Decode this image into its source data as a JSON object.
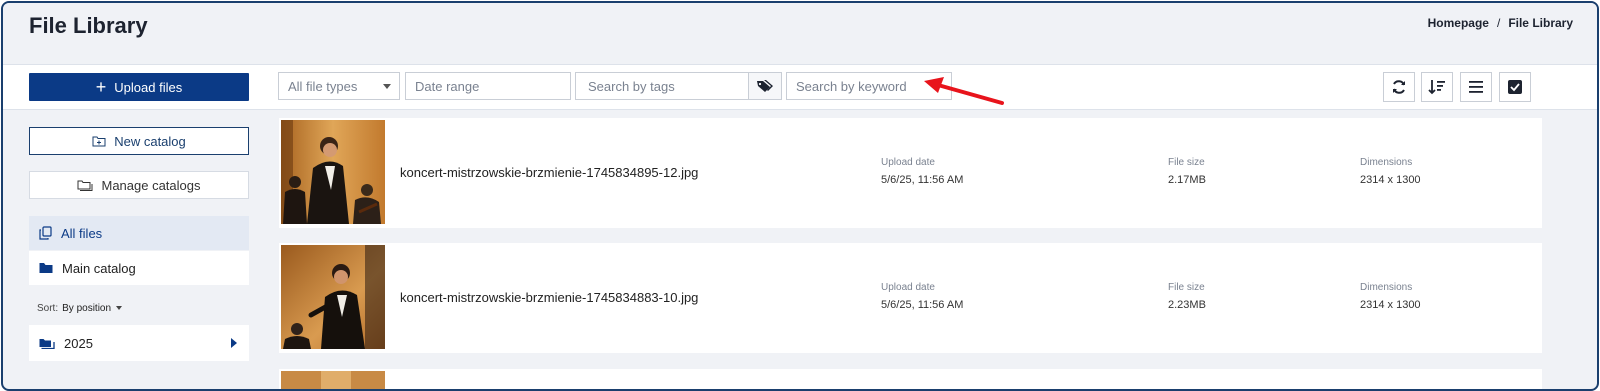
{
  "header": {
    "title": "File Library",
    "breadcrumb": [
      "Homepage",
      "File Library"
    ]
  },
  "toolbar": {
    "upload_label": "Upload files",
    "file_type_value": "All file types",
    "date_range_placeholder": "Date range",
    "tags_placeholder": "Search by tags",
    "keyword_placeholder": "Search by keyword"
  },
  "sidebar": {
    "new_catalog_label": "New catalog",
    "manage_catalogs_label": "Manage catalogs",
    "all_files_label": "All files",
    "main_catalog_label": "Main catalog",
    "sort_label": "Sort:",
    "sort_value": "By position",
    "year_folder_label": "2025"
  },
  "files": [
    {
      "name": "koncert-mistrzowskie-brzmienie-1745834895-12.jpg",
      "upload_label": "Upload date",
      "upload_date": "5/6/25, 11:56 AM",
      "size_label": "File size",
      "size": "2.17MB",
      "dim_label": "Dimensions",
      "dimensions": "2314 x 1300"
    },
    {
      "name": "koncert-mistrzowskie-brzmienie-1745834883-10.jpg",
      "upload_label": "Upload date",
      "upload_date": "5/6/25, 11:56 AM",
      "size_label": "File size",
      "size": "2.23MB",
      "dim_label": "Dimensions",
      "dimensions": "2314 x 1300"
    }
  ],
  "colors": {
    "brand": "#0b3a86",
    "annotation_arrow": "#e8141c"
  },
  "icons": [
    "plus-icon",
    "tag-icon",
    "refresh-icon",
    "sort-icon",
    "list-view-icon",
    "select-all-icon",
    "folder-plus-icon",
    "folders-icon",
    "copy-icon",
    "folder-icon",
    "caret-right-icon"
  ]
}
